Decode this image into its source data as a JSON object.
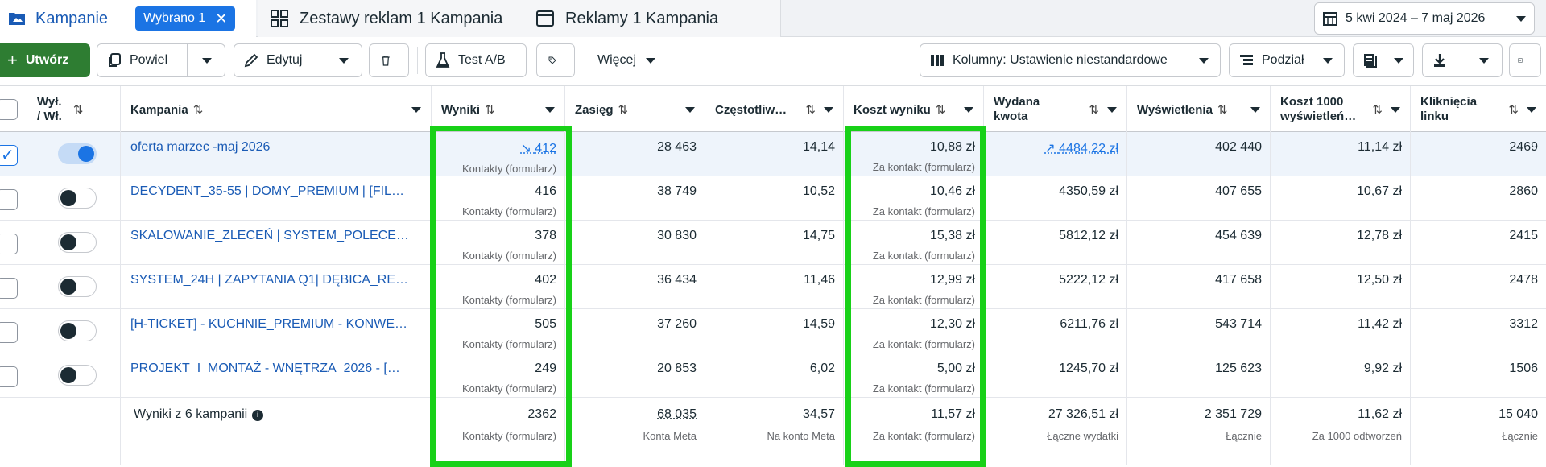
{
  "tabs": {
    "campaigns": "Kampanie",
    "selected_chip": "Wybrano 1",
    "adsets": "Zestawy reklam 1 Kampania",
    "ads": "Reklamy 1 Kampania"
  },
  "date_range": "5 kwi 2024 – 7 maj 2026",
  "toolbar": {
    "create": "Utwórz",
    "duplicate": "Powiel",
    "edit": "Edytuj",
    "ab_test": "Test A/B",
    "more": "Więcej",
    "columns": "Kolumny: Ustawienie niestandardowe",
    "breakdown": "Podział"
  },
  "columns": {
    "delivery_top": "Wył.",
    "delivery_bottom": "/ Wł.",
    "campaign": "Kampania",
    "results": "Wyniki",
    "reach": "Zasięg",
    "frequency": "Częstotliw…",
    "cost_per_result": "Koszt wyniku",
    "spent_top": "Wydana",
    "spent_bottom": "kwota",
    "impressions": "Wyświetlenia",
    "cpm_top": "Koszt 1000",
    "cpm_bottom": "wyświetleń…",
    "link_clicks_top": "Kliknięcia",
    "link_clicks_bottom": "linku"
  },
  "rows": [
    {
      "name": "oferta marzec -maj 2026",
      "results": "412",
      "results_sub": "Kontakty (formularz)",
      "reach": "28 463",
      "frequency": "14,14",
      "cost": "10,88 zł",
      "cost_sub": "Za kontakt (formularz)",
      "spent": "4484,22 zł",
      "impressions": "402 440",
      "cpm": "11,14 zł",
      "clicks": "2469"
    },
    {
      "name": "DECYDENT_35-55 | DOMY_PREMIUM | [FIL…",
      "results": "416",
      "results_sub": "Kontakty (formularz)",
      "reach": "38 749",
      "frequency": "10,52",
      "cost": "10,46 zł",
      "cost_sub": "Za kontakt (formularz)",
      "spent": "4350,59 zł",
      "impressions": "407 655",
      "cpm": "10,67 zł",
      "clicks": "2860"
    },
    {
      "name": "SKALOWANIE_ZLECEŃ | SYSTEM_POLECE…",
      "results": "378",
      "results_sub": "Kontakty (formularz)",
      "reach": "30 830",
      "frequency": "14,75",
      "cost": "15,38 zł",
      "cost_sub": "Za kontakt (formularz)",
      "spent": "5812,12 zł",
      "impressions": "454 639",
      "cpm": "12,78 zł",
      "clicks": "2415"
    },
    {
      "name": "SYSTEM_24H | ZAPYTANIA Q1| DĘBICA_RE…",
      "results": "402",
      "results_sub": "Kontakty (formularz)",
      "reach": "36 434",
      "frequency": "11,46",
      "cost": "12,99 zł",
      "cost_sub": "Za kontakt (formularz)",
      "spent": "5222,12 zł",
      "impressions": "417 658",
      "cpm": "12,50 zł",
      "clicks": "2478"
    },
    {
      "name": "[H-TICKET] - KUCHNIE_PREMIUM - KONWE…",
      "results": "505",
      "results_sub": "Kontakty (formularz)",
      "reach": "37 260",
      "frequency": "14,59",
      "cost": "12,30 zł",
      "cost_sub": "Za kontakt (formularz)",
      "spent": "6211,76 zł",
      "impressions": "543 714",
      "cpm": "11,42 zł",
      "clicks": "3312"
    },
    {
      "name": "PROJEKT_I_MONTAŻ - WNĘTRZA_2026 - […",
      "results": "249",
      "results_sub": "Kontakty (formularz)",
      "reach": "20 853",
      "frequency": "6,02",
      "cost": "5,00 zł",
      "cost_sub": "Za kontakt (formularz)",
      "spent": "1245,70 zł",
      "impressions": "125 623",
      "cpm": "9,92 zł",
      "clicks": "1506"
    }
  ],
  "footer": {
    "label": "Wyniki z 6 kampanii",
    "results": "2362",
    "results_sub": "Kontakty (formularz)",
    "reach": "68 035",
    "reach_sub": "Konta Meta",
    "frequency": "34,57",
    "frequency_sub": "Na konto Meta",
    "cost": "11,57 zł",
    "cost_sub": "Za kontakt (formularz)",
    "spent": "27 326,51 zł",
    "spent_sub": "Łączne wydatki",
    "impressions": "2 351 729",
    "impressions_sub": "Łącznie",
    "cpm": "11,62 zł",
    "cpm_sub": "Za 1000 odtworzeń",
    "clicks": "15 040",
    "clicks_sub": "Łącznie"
  },
  "colors": {
    "highlight": "#18d118",
    "accent": "#1b74e4",
    "create": "#2e7d32"
  }
}
